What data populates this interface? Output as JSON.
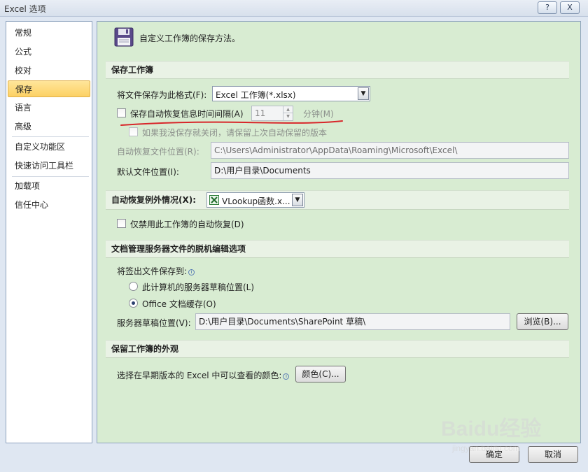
{
  "window": {
    "title": "Excel 选项",
    "help_glyph": "?",
    "close_glyph": "X"
  },
  "sidebar": {
    "items": [
      {
        "label": "常规"
      },
      {
        "label": "公式"
      },
      {
        "label": "校对"
      },
      {
        "label": "保存"
      },
      {
        "label": "语言"
      },
      {
        "label": "高级"
      },
      {
        "label": "自定义功能区"
      },
      {
        "label": "快速访问工具栏"
      },
      {
        "label": "加载项"
      },
      {
        "label": "信任中心"
      }
    ],
    "active_index": 3
  },
  "header": {
    "description": "自定义工作簿的保存方法。"
  },
  "save_workbooks": {
    "section_title": "保存工作簿",
    "format_label": "将文件保存为此格式(F):",
    "format_value": "Excel 工作簿(*.xlsx)",
    "autorecover_label": "保存自动恢复信息时间间隔(A)",
    "autorecover_checked": false,
    "interval_value": "11",
    "interval_unit": "分钟(M)",
    "keep_last_label": "如果我没保存就关闭，请保留上次自动保留的版本",
    "keep_last_checked": false,
    "autorecover_location_label": "自动恢复文件位置(R):",
    "autorecover_location_value": "C:\\Users\\Administrator\\AppData\\Roaming\\Microsoft\\Excel\\",
    "default_location_label": "默认文件位置(I):",
    "default_location_value": "D:\\用户目录\\Documents"
  },
  "autorecover_exceptions": {
    "label": "自动恢复例外情况(X):",
    "workbook_value": "VLookup函数.x...",
    "disable_label": "仅禁用此工作簿的自动恢复(D)",
    "disable_checked": false
  },
  "offline_editing": {
    "section_title": "文档管理服务器文件的脱机编辑选项",
    "save_to_label": "将签出文件保存到:",
    "info_glyph": "i",
    "option1_label": "此计算机的服务器草稿位置(L)",
    "option2_label": "Office 文档缓存(O)",
    "selected_option": 2,
    "drafts_label": "服务器草稿位置(V):",
    "drafts_value": "D:\\用户目录\\Documents\\SharePoint 草稿\\",
    "browse_label": "浏览(B)..."
  },
  "appearance": {
    "section_title": "保留工作簿的外观",
    "colors_label": "选择在早期版本的 Excel 中可以查看的颜色:",
    "info_glyph": "i",
    "colors_button": "颜色(C)..."
  },
  "footer": {
    "ok_label": "确定",
    "cancel_label": "取消"
  },
  "watermark": {
    "text": "Baidu经验",
    "sub": "jingyan.baidu.com"
  }
}
